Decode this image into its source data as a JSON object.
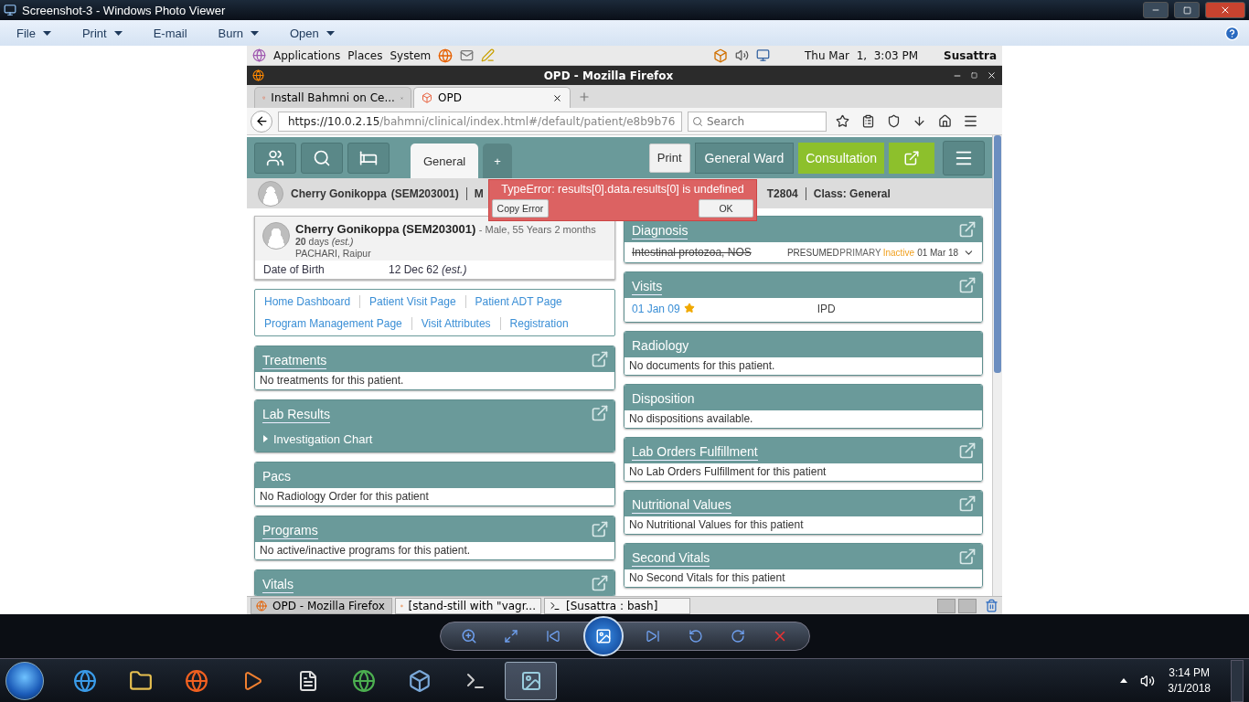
{
  "viewer": {
    "title": "Screenshot-3 - Windows Photo Viewer",
    "menu": [
      {
        "label": "File",
        "dropdown": true
      },
      {
        "label": "Print",
        "dropdown": true
      },
      {
        "label": "E-mail",
        "dropdown": false
      },
      {
        "label": "Burn",
        "dropdown": true
      },
      {
        "label": "Open",
        "dropdown": true
      }
    ]
  },
  "gnome_panel": {
    "menus": [
      "Applications",
      "Places",
      "System"
    ],
    "clock": "Thu Mar  1,  3:03 PM",
    "user": "Susattra"
  },
  "firefox": {
    "title": "OPD - Mozilla Firefox",
    "tabs": [
      {
        "label": "Install Bahmni on Ce...",
        "selected": false
      },
      {
        "label": "OPD",
        "selected": true
      }
    ],
    "url_host": "https://10.0.2.15",
    "url_path": "/bahmni/clinical/index.html#/default/patient/e8b9b76",
    "search_placeholder": "Search"
  },
  "bahmni": {
    "tabs": [
      {
        "label": "General",
        "selected": true
      },
      {
        "label": "+",
        "selected": false
      }
    ],
    "print": "Print",
    "ward": "General Ward",
    "consultation": "Consultation",
    "patient_bar": {
      "name": "Cherry Gonikoppa",
      "id": "(SEM203001)",
      "field_2": "M",
      "field_3": "T2804",
      "class": "Class: General"
    },
    "error": {
      "message": "TypeError: results[0].data.results[0] is undefined",
      "copy": "Copy Error",
      "ok": "OK"
    },
    "patient_card": {
      "name": "Cherry Gonikoppa (SEM203001)",
      "summary": "- Male, 55 Years 2 months",
      "age": "**20** days *(est.)*",
      "address": "PACHARI, Raipur",
      "dob_label": "Date of Birth",
      "dob": "12 Dec 62 *(est.)*"
    },
    "links": [
      [
        "Home Dashboard",
        "Patient Visit Page",
        "Patient ADT Page"
      ],
      [
        "Program Management Page",
        "Visit Attributes",
        "Registration"
      ]
    ],
    "left_sections": [
      {
        "title": "Treatments",
        "link": true,
        "kind": "text",
        "text": "No treatments for this patient."
      },
      {
        "title": "Lab Results",
        "link": true,
        "kind": "tree",
        "text": "Investigation Chart"
      },
      {
        "title": "Pacs",
        "link": false,
        "kind": "text",
        "text": "No Radiology Order for this patient"
      },
      {
        "title": "Programs",
        "link": true,
        "kind": "text",
        "text": "No active/inactive programs for this patient."
      },
      {
        "title": "Vitals",
        "link": true,
        "kind": "none"
      }
    ],
    "right_sections": [
      {
        "title": "Diagnosis",
        "link": true,
        "kind": "diagnosis",
        "diagnosis": {
          "name": "Intestinal protozoa, NOS",
          "struck": true,
          "certainty": "PRESUMED",
          "order": "PRIMARY",
          "status": "Inactive",
          "date": "01 Mar 18"
        }
      },
      {
        "title": "Visits",
        "link": true,
        "kind": "visit",
        "visit": {
          "date": "01 Jan 09",
          "starred": true,
          "type": "IPD"
        }
      },
      {
        "title": "Radiology",
        "link": false,
        "kind": "text",
        "text": "No documents for this patient."
      },
      {
        "title": "Disposition",
        "link": false,
        "kind": "text",
        "text": "No dispositions available."
      },
      {
        "title": "Lab Orders Fulfillment",
        "link": true,
        "kind": "text",
        "text": "No Lab Orders Fulfillment for this patient"
      },
      {
        "title": "Nutritional Values",
        "link": true,
        "kind": "text",
        "text": "No Nutritional Values for this patient"
      },
      {
        "title": "Second Vitals",
        "link": true,
        "kind": "text",
        "text": "No Second Vitals for this patient"
      }
    ]
  },
  "gnome_tasks": [
    {
      "label": "OPD - Mozilla Firefox",
      "selected": true
    },
    {
      "label": "[stand-still with \"vagr...",
      "selected": false
    },
    {
      "label": "[Susattra : bash]",
      "selected": false
    }
  ],
  "taskbar": {
    "time": "3:14 PM",
    "date": "3/1/2018"
  }
}
